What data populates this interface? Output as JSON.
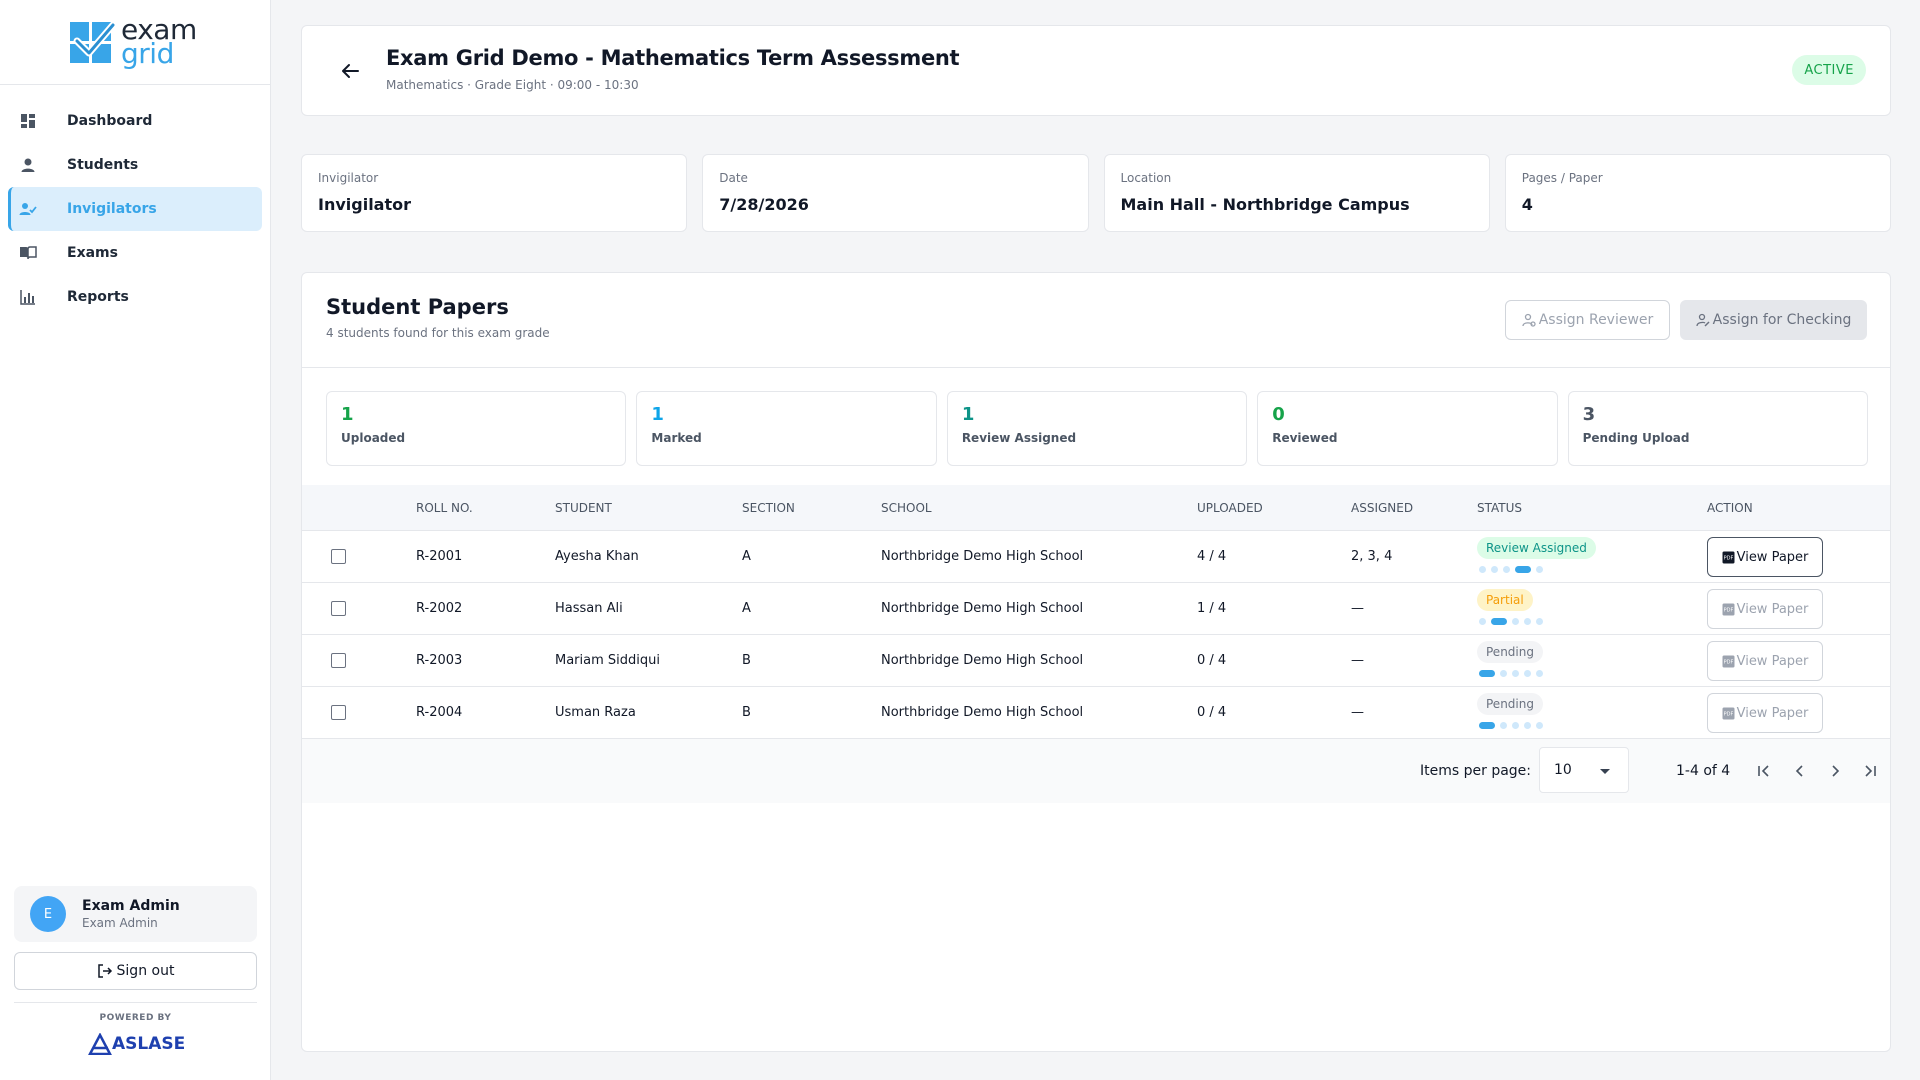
{
  "brand": {
    "line1": "exam",
    "line2": "grid",
    "colors": {
      "accent": "#38a5e8",
      "dark": "#1f2937"
    }
  },
  "sidebar": {
    "items": [
      {
        "label": "Dashboard",
        "icon": "dashboard-icon",
        "active": false
      },
      {
        "label": "Students",
        "icon": "students-icon",
        "active": false
      },
      {
        "label": "Invigilators",
        "icon": "invigilators-icon",
        "active": true
      },
      {
        "label": "Exams",
        "icon": "exams-icon",
        "active": false
      },
      {
        "label": "Reports",
        "icon": "reports-icon",
        "active": false
      }
    ],
    "user": {
      "initial": "E",
      "name": "Exam Admin",
      "role": "Exam Admin"
    },
    "signout_label": "Sign out",
    "powered_by": "POWERED BY",
    "powered_brand": "ASLASE"
  },
  "header": {
    "title": "Exam Grid Demo - Mathematics Term Assessment",
    "subtitle": "Mathematics · Grade Eight · 09:00 - 10:30",
    "status": "ACTIVE"
  },
  "info": [
    {
      "label": "Invigilator",
      "value": "Invigilator"
    },
    {
      "label": "Date",
      "value": "7/28/2026"
    },
    {
      "label": "Location",
      "value": "Main Hall - Northbridge Campus"
    },
    {
      "label": "Pages / Paper",
      "value": "4"
    }
  ],
  "papers": {
    "title": "Student Papers",
    "subtitle": "4 students found for this exam grade",
    "assign_reviewer_label": "Assign Reviewer",
    "assign_checking_label": "Assign for Checking",
    "stats": [
      {
        "value": "1",
        "label": "Uploaded",
        "color": "#16a34a"
      },
      {
        "value": "1",
        "label": "Marked",
        "color": "#0ea5e9"
      },
      {
        "value": "1",
        "label": "Review Assigned",
        "color": "#0d9488"
      },
      {
        "value": "0",
        "label": "Reviewed",
        "color": "#16a34a"
      },
      {
        "value": "3",
        "label": "Pending Upload",
        "color": "#4b5563"
      }
    ],
    "columns": [
      "ROLL NO.",
      "STUDENT",
      "SECTION",
      "SCHOOL",
      "UPLOADED",
      "ASSIGNED",
      "STATUS",
      "ACTION"
    ],
    "rows": [
      {
        "roll": "R-2001",
        "student": "Ayesha Khan",
        "section": "A",
        "school": "Northbridge Demo High School",
        "uploaded": "4 / 4",
        "assigned": "2, 3, 4",
        "status": "Review Assigned",
        "status_fg": "#0d9488",
        "status_bg": "#dcfce7",
        "progress_step": 4,
        "action": "View Paper",
        "action_enabled": true
      },
      {
        "roll": "R-2002",
        "student": "Hassan Ali",
        "section": "A",
        "school": "Northbridge Demo High School",
        "uploaded": "1 / 4",
        "assigned": "—",
        "status": "Partial",
        "status_fg": "#f59e0b",
        "status_bg": "#fef3c7",
        "progress_step": 2,
        "action": "View Paper",
        "action_enabled": false
      },
      {
        "roll": "R-2003",
        "student": "Mariam Siddiqui",
        "section": "B",
        "school": "Northbridge Demo High School",
        "uploaded": "0 / 4",
        "assigned": "—",
        "status": "Pending",
        "status_fg": "#6b7280",
        "status_bg": "#f3f4f6",
        "progress_step": 1,
        "action": "View Paper",
        "action_enabled": false
      },
      {
        "roll": "R-2004",
        "student": "Usman Raza",
        "section": "B",
        "school": "Northbridge Demo High School",
        "uploaded": "0 / 4",
        "assigned": "—",
        "status": "Pending",
        "status_fg": "#6b7280",
        "status_bg": "#f3f4f6",
        "progress_step": 1,
        "action": "View Paper",
        "action_enabled": false
      }
    ],
    "pagination": {
      "items_label": "Items per page:",
      "per_page": "10",
      "range": "1-4 of 4"
    }
  }
}
